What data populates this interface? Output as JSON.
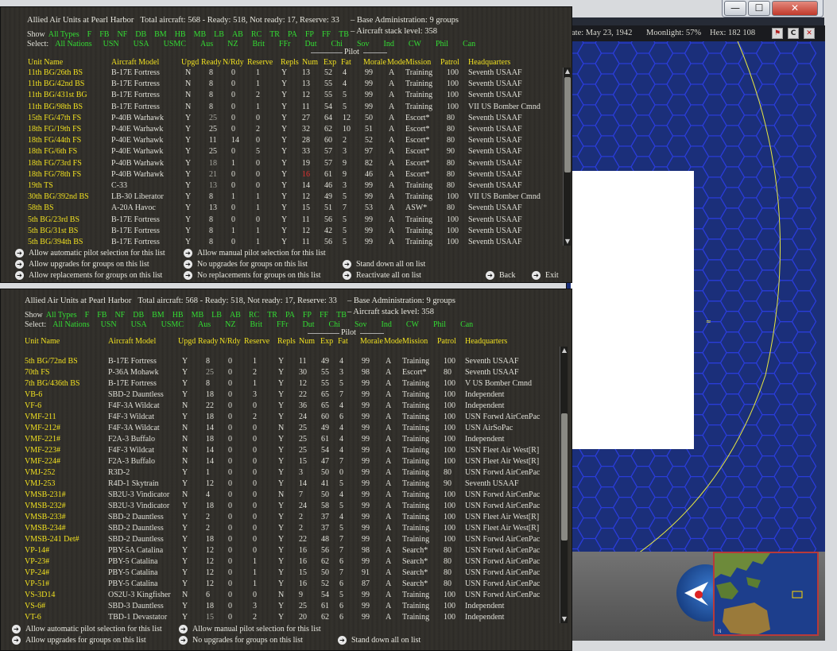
{
  "window": {
    "minimize": "—",
    "maximize": "☐",
    "close": "✕"
  },
  "map": {
    "date": "ate: May 23, 1942",
    "moonlight": "Moonlight: 57%",
    "hex": "Hex: 182 108",
    "btn1": "⚑",
    "btn2": "C",
    "btn3": "✕"
  },
  "filters": {
    "show_label": "Show",
    "all_types": "All Types",
    "types": [
      "F",
      "FB",
      "NF",
      "DB",
      "BM",
      "HB",
      "MB",
      "LB",
      "AB",
      "RC",
      "TR",
      "PA",
      "FP",
      "FF",
      "TB"
    ],
    "select_label": "Select:",
    "all_nations": "All Nations",
    "nations": [
      "USN",
      "USA",
      "USMC",
      "Aus",
      "NZ",
      "Brit",
      "FFr",
      "Dut",
      "Chi",
      "Sov",
      "Ind",
      "CW",
      "Phil",
      "Can"
    ]
  },
  "columns": {
    "unit": "Unit Name",
    "model": "Aircraft Model",
    "upgd": "Upgd",
    "ready": "Ready",
    "nrdy": "N/Rdy",
    "reserve": "Reserve",
    "repls": "Repls",
    "pilot": "Pilot",
    "num": "Num",
    "exp": "Exp",
    "fat": "Fat",
    "morale": "Morale",
    "mode": "Mode",
    "mission": "Mission",
    "patrol": "Patrol",
    "hq": "Headquarters"
  },
  "panel1": {
    "title": "Allied Air Units at Pearl Harbor",
    "totals": "Total aircraft: 568 - Ready: 518, Not ready: 17, Reserve: 33",
    "base_admin": "– Base Administration: 9 groups",
    "stack_level": "– Aircraft stack level: 358",
    "rows": [
      [
        "11th BG/26th BS",
        "B-17E Fortress",
        "N",
        "8",
        "0",
        "1",
        "Y",
        "13",
        "52",
        "4",
        "99",
        "A",
        "Training",
        "100",
        "Seventh USAAF"
      ],
      [
        "11th BG/42nd BS",
        "B-17E Fortress",
        "N",
        "8",
        "0",
        "1",
        "Y",
        "13",
        "55",
        "4",
        "99",
        "A",
        "Training",
        "100",
        "Seventh USAAF"
      ],
      [
        "11th BG/431st BG",
        "B-17E Fortress",
        "N",
        "8",
        "0",
        "2",
        "Y",
        "12",
        "55",
        "5",
        "99",
        "A",
        "Training",
        "100",
        "Seventh USAAF"
      ],
      [
        "11th BG/98th BS",
        "B-17E Fortress",
        "N",
        "8",
        "0",
        "1",
        "Y",
        "11",
        "54",
        "5",
        "99",
        "A",
        "Training",
        "100",
        "VII US Bomber Cmnd"
      ],
      [
        "15th FG/47th FS",
        "P-40B Warhawk",
        "Y",
        "25",
        "0",
        "0",
        "Y",
        "27",
        "64",
        "12",
        "50",
        "A",
        "Escort*",
        "80",
        "Seventh USAAF"
      ],
      [
        "18th FG/19th FS",
        "P-40E Warhawk",
        "Y",
        "25",
        "0",
        "2",
        "Y",
        "32",
        "62",
        "10",
        "51",
        "A",
        "Escort*",
        "80",
        "Seventh USAAF"
      ],
      [
        "18th FG/44th FS",
        "P-40E Warhawk",
        "Y",
        "11",
        "14",
        "0",
        "Y",
        "28",
        "60",
        "2",
        "52",
        "A",
        "Escort*",
        "80",
        "Seventh USAAF"
      ],
      [
        "18th FG/6th FS",
        "P-40E Warhawk",
        "Y",
        "25",
        "0",
        "5",
        "Y",
        "33",
        "57",
        "3",
        "97",
        "A",
        "Escort*",
        "90",
        "Seventh USAAF"
      ],
      [
        "18th FG/73rd FS",
        "P-40B Warhawk",
        "Y",
        "18",
        "1",
        "0",
        "Y",
        "19",
        "57",
        "9",
        "82",
        "A",
        "Escort*",
        "80",
        "Seventh USAAF"
      ],
      [
        "18th FG/78th FS",
        "P-40B Warhawk",
        "Y",
        "21",
        "0",
        "0",
        "Y",
        "16",
        "61",
        "9",
        "46",
        "A",
        "Escort*",
        "80",
        "Seventh USAAF"
      ],
      [
        "19th TS",
        "C-33",
        "Y",
        "13",
        "0",
        "0",
        "Y",
        "14",
        "46",
        "3",
        "99",
        "A",
        "Training",
        "80",
        "Seventh USAAF"
      ],
      [
        "30th BG/392nd BS",
        "LB-30 Liberator",
        "Y",
        "8",
        "1",
        "1",
        "Y",
        "12",
        "49",
        "5",
        "99",
        "A",
        "Training",
        "100",
        "VII US Bomber Cmnd"
      ],
      [
        "58th BS",
        "A-20A Havoc",
        "Y",
        "13",
        "0",
        "1",
        "Y",
        "15",
        "51",
        "7",
        "53",
        "A",
        "ASW*",
        "80",
        "Seventh USAAF"
      ],
      [
        "5th BG/23rd BS",
        "B-17E Fortress",
        "Y",
        "8",
        "0",
        "0",
        "Y",
        "11",
        "56",
        "5",
        "99",
        "A",
        "Training",
        "100",
        "Seventh USAAF"
      ],
      [
        "5th BG/31st BS",
        "B-17E Fortress",
        "Y",
        "8",
        "1",
        "1",
        "Y",
        "12",
        "42",
        "5",
        "99",
        "A",
        "Training",
        "100",
        "Seventh USAAF"
      ],
      [
        "5th BG/394th BS",
        "B-17E Fortress",
        "Y",
        "8",
        "0",
        "1",
        "Y",
        "11",
        "56",
        "5",
        "99",
        "A",
        "Training",
        "100",
        "Seventh USAAF"
      ]
    ],
    "actions": [
      [
        "Allow automatic pilot selection for this list",
        "Allow manual pilot selection for this list",
        ""
      ],
      [
        "Allow upgrades for groups on this list",
        "No upgrades for groups on this list",
        "Stand down all on list"
      ],
      [
        "Allow replacements for groups on this list",
        "No replacements for groups on this list",
        "Reactivate all on list"
      ]
    ],
    "back": "Back",
    "exit": "Exit"
  },
  "panel2": {
    "title": "Allied Air Units at Pearl Harbor",
    "totals": "Total aircraft: 568 - Ready: 518, Not ready: 17, Reserve: 33",
    "base_admin": "– Base Administration: 9 groups",
    "stack_level": "– Aircraft stack level: 358",
    "rows": [
      [
        "5th BG/72nd BS",
        "B-17E Fortress",
        "Y",
        "8",
        "0",
        "1",
        "Y",
        "11",
        "49",
        "4",
        "99",
        "A",
        "Training",
        "100",
        "Seventh USAAF"
      ],
      [
        "70th FS",
        "P-36A Mohawk",
        "Y",
        "25",
        "0",
        "2",
        "Y",
        "30",
        "55",
        "3",
        "98",
        "A",
        "Escort*",
        "80",
        "Seventh USAAF"
      ],
      [
        "7th BG/436th BS",
        "B-17E Fortress",
        "Y",
        "8",
        "0",
        "1",
        "Y",
        "12",
        "55",
        "5",
        "99",
        "A",
        "Training",
        "100",
        "V US Bomber Cmnd"
      ],
      [
        "VB-6",
        "SBD-2 Dauntless",
        "Y",
        "18",
        "0",
        "3",
        "Y",
        "22",
        "65",
        "7",
        "99",
        "A",
        "Training",
        "100",
        "Independent"
      ],
      [
        "VF-6",
        "F4F-3A Wildcat",
        "N",
        "22",
        "0",
        "0",
        "Y",
        "36",
        "65",
        "4",
        "99",
        "A",
        "Training",
        "100",
        "Independent"
      ],
      [
        "VMF-211",
        "F4F-3 Wildcat",
        "Y",
        "18",
        "0",
        "2",
        "Y",
        "24",
        "60",
        "6",
        "99",
        "A",
        "Training",
        "100",
        "USN Forwd AirCenPac"
      ],
      [
        "VMF-212#",
        "F4F-3A Wildcat",
        "N",
        "14",
        "0",
        "0",
        "N",
        "25",
        "49",
        "4",
        "99",
        "A",
        "Training",
        "100",
        "USN AirSoPac"
      ],
      [
        "VMF-221#",
        "F2A-3 Buffalo",
        "N",
        "18",
        "0",
        "0",
        "Y",
        "25",
        "61",
        "4",
        "99",
        "A",
        "Training",
        "100",
        "Independent"
      ],
      [
        "VMF-223#",
        "F4F-3 Wildcat",
        "N",
        "14",
        "0",
        "0",
        "Y",
        "25",
        "54",
        "4",
        "99",
        "A",
        "Training",
        "100",
        "USN Fleet Air West[R]"
      ],
      [
        "VMF-224#",
        "F2A-3 Buffalo",
        "N",
        "14",
        "0",
        "0",
        "Y",
        "15",
        "47",
        "7",
        "99",
        "A",
        "Training",
        "100",
        "USN Fleet Air West[R]"
      ],
      [
        "VMJ-252",
        "R3D-2",
        "Y",
        "1",
        "0",
        "0",
        "Y",
        "3",
        "50",
        "0",
        "99",
        "A",
        "Training",
        "80",
        "USN Forwd AirCenPac"
      ],
      [
        "VMJ-253",
        "R4D-1 Skytrain",
        "Y",
        "12",
        "0",
        "0",
        "Y",
        "14",
        "41",
        "5",
        "99",
        "A",
        "Training",
        "90",
        "Seventh USAAF"
      ],
      [
        "VMSB-231#",
        "SB2U-3 Vindicator",
        "N",
        "4",
        "0",
        "0",
        "N",
        "7",
        "50",
        "4",
        "99",
        "A",
        "Training",
        "100",
        "USN Forwd AirCenPac"
      ],
      [
        "VMSB-232#",
        "SB2U-3 Vindicator",
        "Y",
        "18",
        "0",
        "0",
        "Y",
        "24",
        "58",
        "5",
        "99",
        "A",
        "Training",
        "100",
        "USN Forwd AirCenPac"
      ],
      [
        "VMSB-233#",
        "SBD-2 Dauntless",
        "Y",
        "2",
        "0",
        "0",
        "Y",
        "2",
        "37",
        "4",
        "99",
        "A",
        "Training",
        "100",
        "USN Fleet Air West[R]"
      ],
      [
        "VMSB-234#",
        "SBD-2 Dauntless",
        "Y",
        "2",
        "0",
        "0",
        "Y",
        "2",
        "37",
        "5",
        "99",
        "A",
        "Training",
        "100",
        "USN Fleet Air West[R]"
      ],
      [
        "VMSB-241 Det#",
        "SBD-2 Dauntless",
        "Y",
        "18",
        "0",
        "0",
        "Y",
        "22",
        "48",
        "7",
        "99",
        "A",
        "Training",
        "100",
        "USN Forwd AirCenPac"
      ],
      [
        "VP-14#",
        "PBY-5A Catalina",
        "Y",
        "12",
        "0",
        "0",
        "Y",
        "16",
        "56",
        "7",
        "98",
        "A",
        "Search*",
        "80",
        "USN Forwd AirCenPac"
      ],
      [
        "VP-23#",
        "PBY-5 Catalina",
        "Y",
        "12",
        "0",
        "1",
        "Y",
        "16",
        "62",
        "6",
        "99",
        "A",
        "Search*",
        "80",
        "USN Forwd AirCenPac"
      ],
      [
        "VP-24#",
        "PBY-5 Catalina",
        "Y",
        "12",
        "0",
        "1",
        "Y",
        "15",
        "50",
        "7",
        "91",
        "A",
        "Search*",
        "80",
        "USN Forwd AirCenPac"
      ],
      [
        "VP-51#",
        "PBY-5 Catalina",
        "Y",
        "12",
        "0",
        "1",
        "Y",
        "16",
        "52",
        "6",
        "87",
        "A",
        "Search*",
        "80",
        "USN Forwd AirCenPac"
      ],
      [
        "VS-3D14",
        "OS2U-3 Kingfisher",
        "N",
        "6",
        "0",
        "0",
        "N",
        "9",
        "54",
        "5",
        "99",
        "A",
        "Training",
        "100",
        "USN Forwd AirCenPac"
      ],
      [
        "VS-6#",
        "SBD-3 Dauntless",
        "Y",
        "18",
        "0",
        "3",
        "Y",
        "25",
        "61",
        "6",
        "99",
        "A",
        "Training",
        "100",
        "Independent"
      ],
      [
        "VT-6",
        "TBD-1 Devastator",
        "Y",
        "15",
        "0",
        "2",
        "Y",
        "20",
        "62",
        "6",
        "99",
        "A",
        "Training",
        "100",
        "Independent"
      ]
    ],
    "actions": [
      [
        "Allow automatic pilot selection for this list",
        "Allow manual pilot selection for this list",
        ""
      ],
      [
        "Allow upgrades for groups on this list",
        "No upgrades for groups on this list",
        "Stand down all on list"
      ]
    ]
  }
}
